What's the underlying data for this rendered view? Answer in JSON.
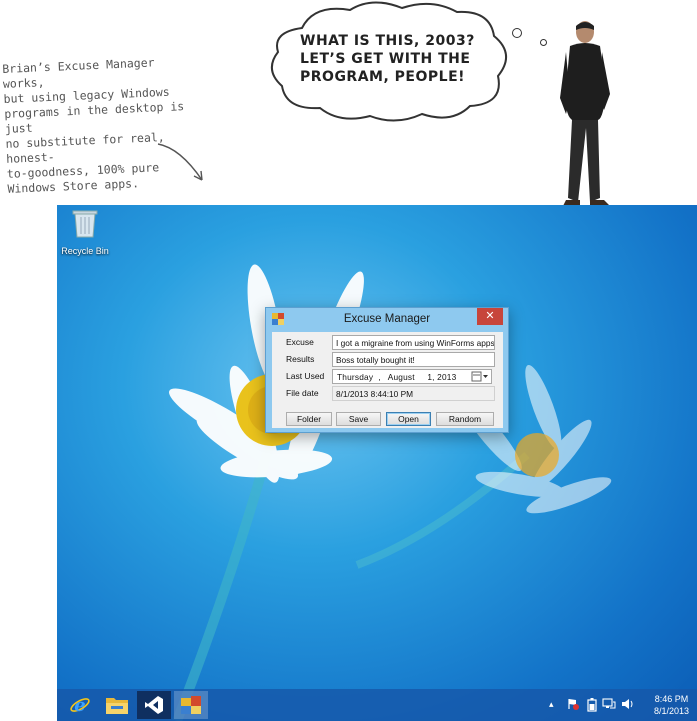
{
  "annotation": {
    "text": "Brian’s Excuse Manager works,\nbut using legacy Windows\nprograms in the desktop is just\nno substitute for real, honest-\nto-goodness, 100% pure\nWindows Store apps."
  },
  "thought": {
    "text": "What is this, 2003? Let’s get with the program, people!"
  },
  "desktop": {
    "recycle_bin_label": "Recycle Bin"
  },
  "window": {
    "title": "Excuse Manager",
    "close_glyph": "✕",
    "fields": {
      "excuse_label": "Excuse",
      "excuse_value": "I got a migraine from using WinForms apps",
      "results_label": "Results",
      "results_value": "Boss totally bought it!",
      "last_used_label": "Last Used",
      "last_used_value": "Thursday  ,   August     1, 2013",
      "file_date_label": "File date",
      "file_date_value": "8/1/2013 8:44:10 PM"
    },
    "buttons": {
      "folder": "Folder",
      "save": "Save",
      "open": "Open",
      "random": "Random"
    }
  },
  "taskbar": {
    "apps": [
      "internet-explorer-icon",
      "file-explorer-icon",
      "visual-studio-icon",
      "excuse-manager-icon"
    ],
    "tray_chevron": "▴",
    "clock_time": "8:46 PM",
    "clock_date": "8/1/2013"
  },
  "colors": {
    "desktop_blue": "#1a86d6",
    "window_frame": "#8ec9ef",
    "close_red": "#c7453b",
    "taskbar": "#1658aa"
  }
}
